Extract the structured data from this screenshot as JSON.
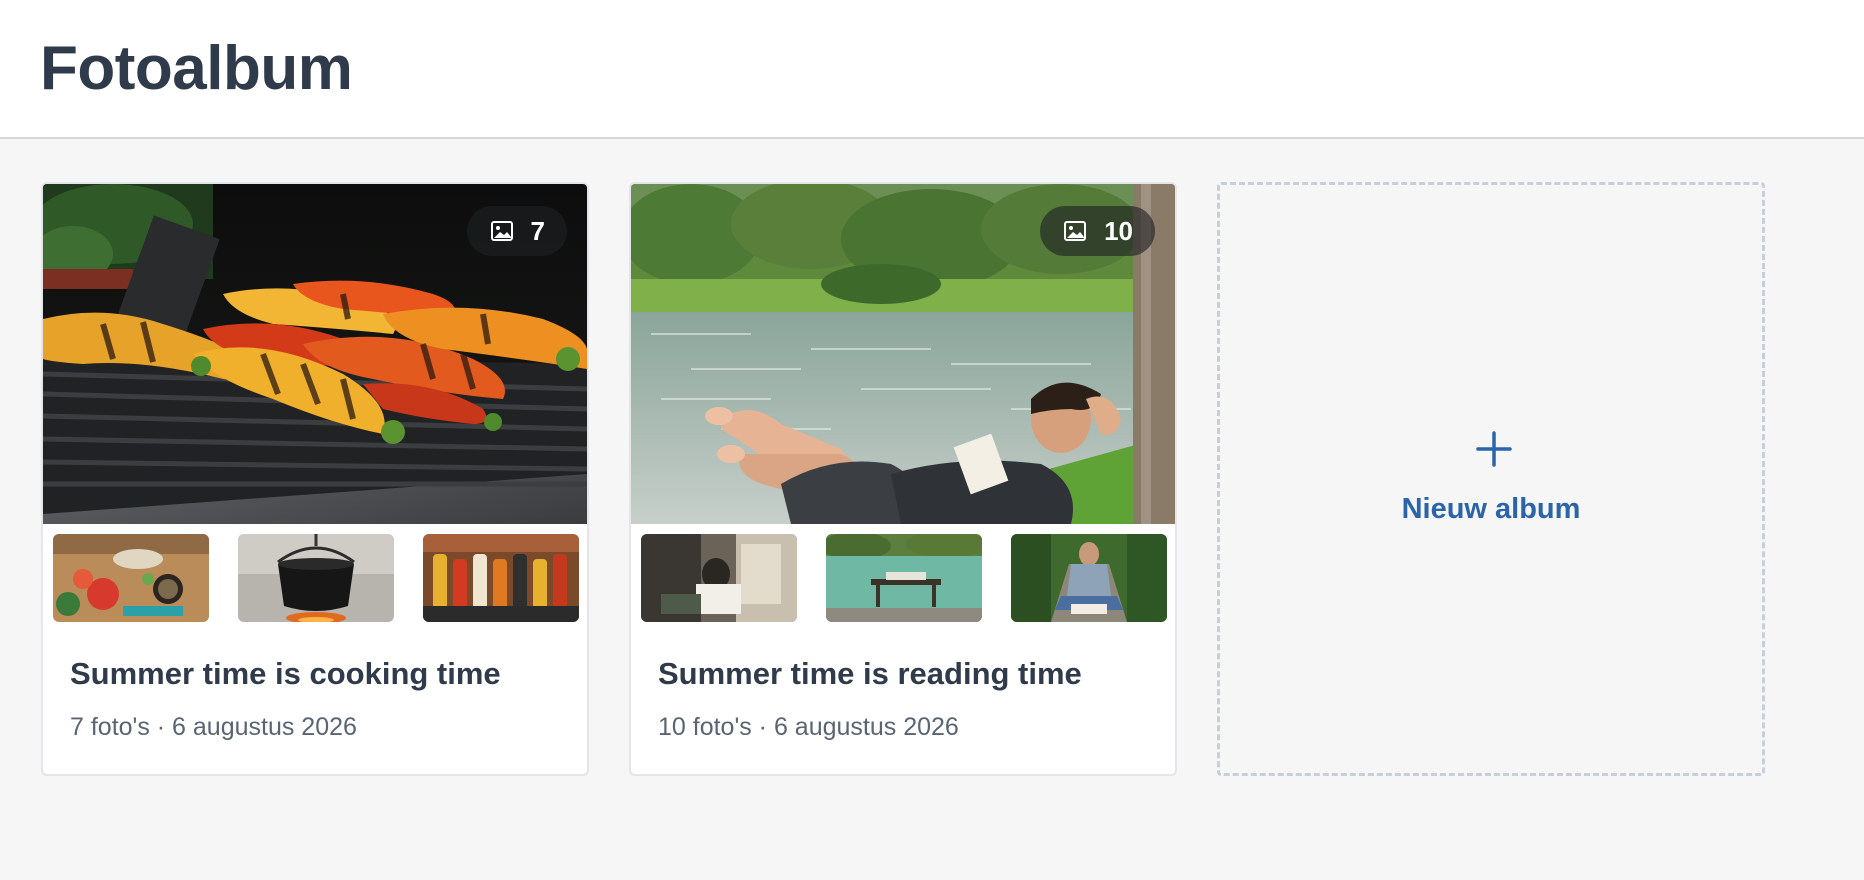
{
  "header": {
    "title": "Fotoalbum"
  },
  "albums": [
    {
      "title": "Summer time is cooking time",
      "photo_count": "7",
      "meta": "7 foto's · 6 augustus 2026",
      "cover_image": "grilled peppers on barbecue grill",
      "thumbnails": [
        "vegetables on cutting board",
        "cooking pot over campfire",
        "vegetable skewers on grill"
      ]
    },
    {
      "title": "Summer time is reading time",
      "photo_count": "10",
      "meta": "10 foto's · 6 augustus 2026",
      "cover_image": "man reading on grass by a lake",
      "thumbnails": [
        "person reading on terrace",
        "person lying on bench by lake",
        "man reading cross-legged on path"
      ]
    }
  ],
  "new_album": {
    "label": "Nieuw album"
  },
  "icons": {
    "badge": "image-icon",
    "new_album": "plus-icon"
  },
  "colors": {
    "title_text": "#2f3a4a",
    "meta_text": "#5a6472",
    "accent": "#2b64a8",
    "dashed_border": "#c7cfda",
    "background": "#f6f6f6"
  }
}
